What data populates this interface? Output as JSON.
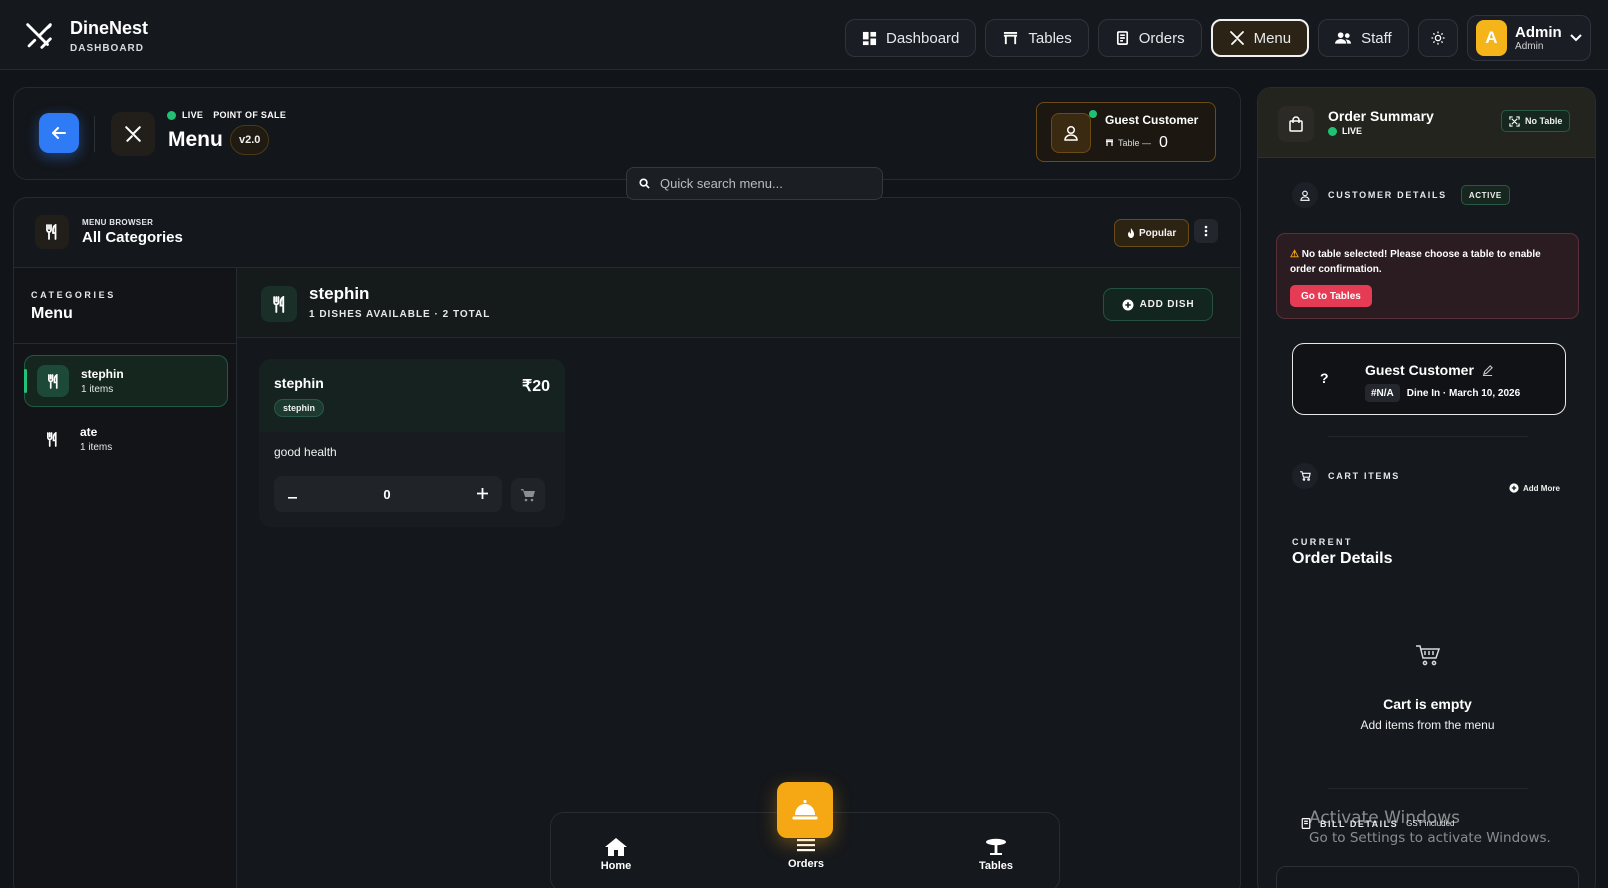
{
  "app": {
    "brand_name": "DineNest",
    "brand_sub": "DASHBOARD",
    "nav": [
      {
        "label": "Dashboard",
        "icon": "dashboard-icon"
      },
      {
        "label": "Tables",
        "icon": "table-icon"
      },
      {
        "label": "Orders",
        "icon": "receipt-icon"
      },
      {
        "label": "Menu",
        "icon": "utensils-icon",
        "active": true
      },
      {
        "label": "Staff",
        "icon": "users-icon"
      }
    ],
    "theme_icon": "sun-icon",
    "user": {
      "initial": "A",
      "name": "Admin",
      "role": "Admin"
    }
  },
  "header": {
    "live_label": "LIVE",
    "pos_label": "POINT OF SALE",
    "title": "Menu",
    "version": "v2.0",
    "guest": {
      "name": "Guest Customer",
      "table_label": "Table —",
      "table_value": "0"
    }
  },
  "search": {
    "placeholder": "Quick search menu..."
  },
  "browser": {
    "label": "MENU BROWSER",
    "title": "All Categories",
    "popular_label": "Popular",
    "sidebar": {
      "caption": "CATEGORIES",
      "title": "Menu",
      "items": [
        {
          "name": "stephin",
          "count": "1 items",
          "active": true
        },
        {
          "name": "ate",
          "count": "1 items",
          "active": false
        }
      ]
    },
    "category_header": {
      "title": "stephin",
      "subtitle": "1 DISHES AVAILABLE · 2 TOTAL",
      "add_label": "ADD DISH"
    },
    "dishes": [
      {
        "name": "stephin",
        "price": "₹20",
        "tag": "stephin",
        "description": "good health",
        "quantity": "0"
      }
    ]
  },
  "bottom_nav": {
    "items": [
      {
        "label": "Home",
        "icon": "home-icon"
      },
      {
        "label": "Orders",
        "icon": "list-icon"
      },
      {
        "label": "Tables",
        "icon": "table-icon"
      }
    ],
    "fab_icon": "service-bell-icon"
  },
  "summary": {
    "title": "Order Summary",
    "live_label": "LIVE",
    "no_table_label": "No Table",
    "customer_section": "CUSTOMER DETAILS",
    "active_label": "ACTIVE",
    "alert_text": "No table selected! Please choose a table to enable order confirmation.",
    "alert_button": "Go to Tables",
    "customer": {
      "avatar": "?",
      "name": "Guest Customer",
      "id": "#N/A",
      "meta": "Dine In · March 10, 2026"
    },
    "cart_section": "CART ITEMS",
    "add_more": "Add More",
    "current_caption": "CURRENT",
    "current_title": "Order Details",
    "empty_title": "Cart is empty",
    "empty_sub": "Add items from the menu",
    "bill_section": "BILL DETAILS",
    "gst_label": "GST included"
  },
  "watermark": {
    "line1": "Activate Windows",
    "line2": "Go to Settings to activate Windows."
  },
  "colors": {
    "accent_amber": "#f5a714",
    "accent_green": "#20c172",
    "accent_blue": "#2f7af5",
    "alert_red": "#e63b55"
  }
}
